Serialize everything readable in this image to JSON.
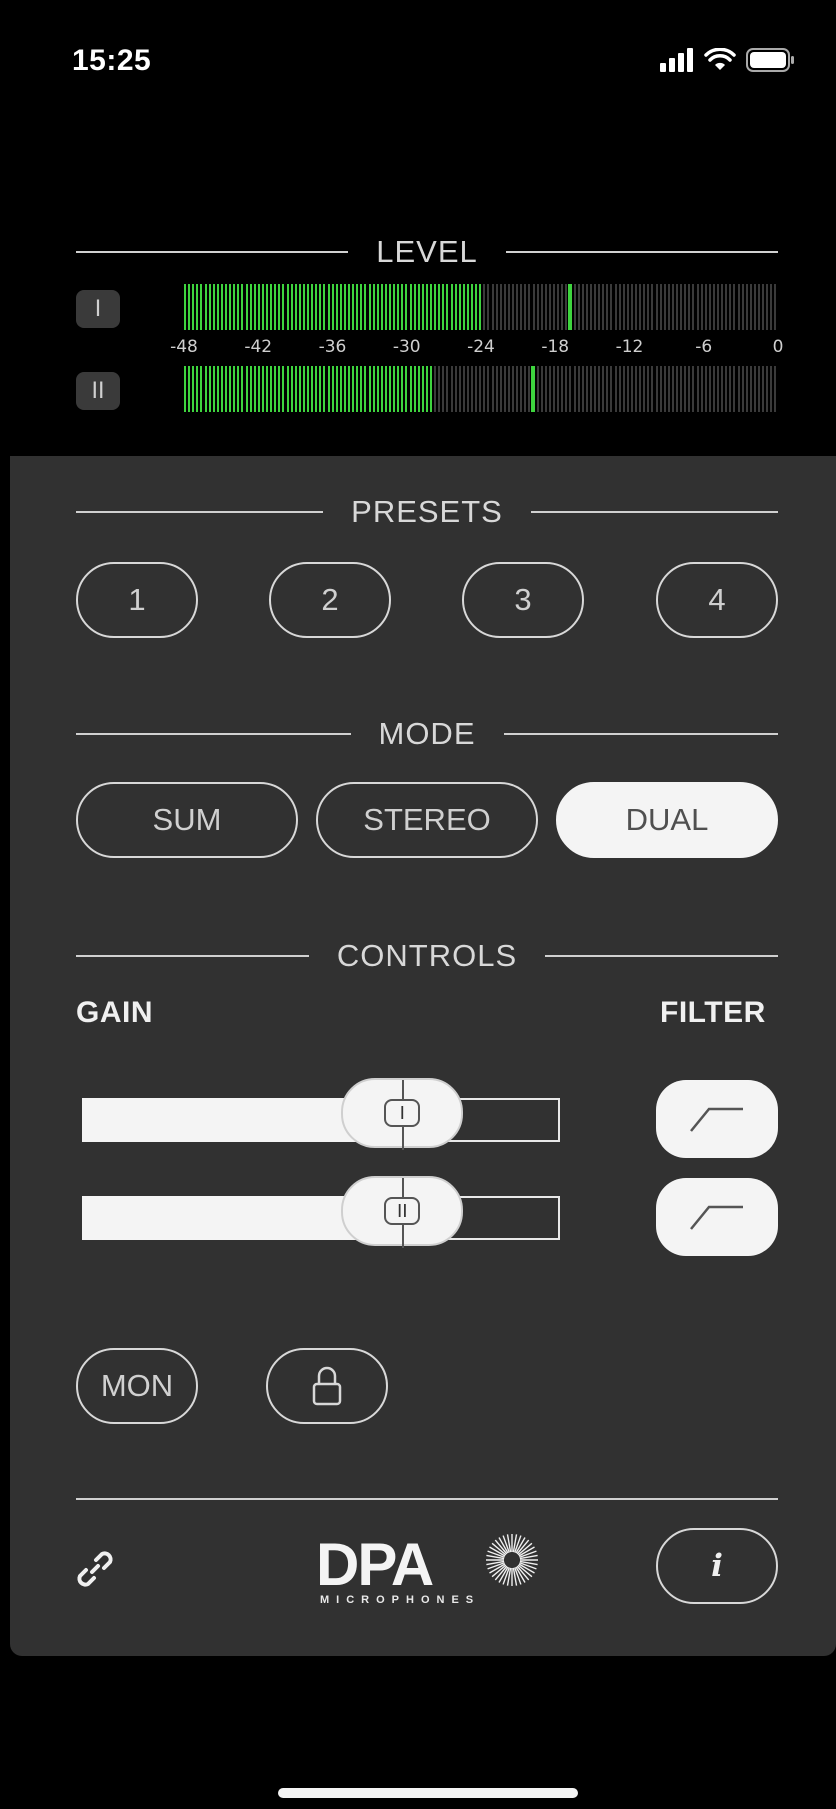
{
  "status_bar": {
    "time": "15:25",
    "icons": [
      "cellular-signal-icon",
      "wifi-icon",
      "battery-icon"
    ]
  },
  "level": {
    "title": "LEVEL",
    "channels": [
      {
        "badge": "I",
        "level_db": -24,
        "peak_db": -17
      },
      {
        "badge": "II",
        "level_db": -28,
        "peak_db": -20
      }
    ],
    "scale": [
      "-48",
      "-42",
      "-36",
      "-30",
      "-24",
      "-18",
      "-12",
      "-6",
      "0"
    ]
  },
  "presets": {
    "title": "PRESETS",
    "buttons": [
      "1",
      "2",
      "3",
      "4"
    ]
  },
  "mode": {
    "title": "MODE",
    "options": [
      "SUM",
      "STEREO",
      "DUAL"
    ],
    "selected": "DUAL"
  },
  "controls": {
    "title": "CONTROLS",
    "gain_label": "GAIN",
    "filter_label": "FILTER",
    "sliders": [
      {
        "thumb_label": "I",
        "value_fraction": 0.67
      },
      {
        "thumb_label": "II",
        "value_fraction": 0.67
      }
    ],
    "filter_icon": "high-pass-filter-icon"
  },
  "bottom": {
    "mon_label": "MON",
    "lock_icon": "lock-icon",
    "link_icon": "link-icon",
    "info_label": "i"
  },
  "logo": {
    "text": "DPA",
    "sub": "MICROPHONES"
  },
  "colors": {
    "meter_active": "#3ed43e",
    "meter_inactive": "#3a3a3a",
    "panel": "#313131"
  }
}
